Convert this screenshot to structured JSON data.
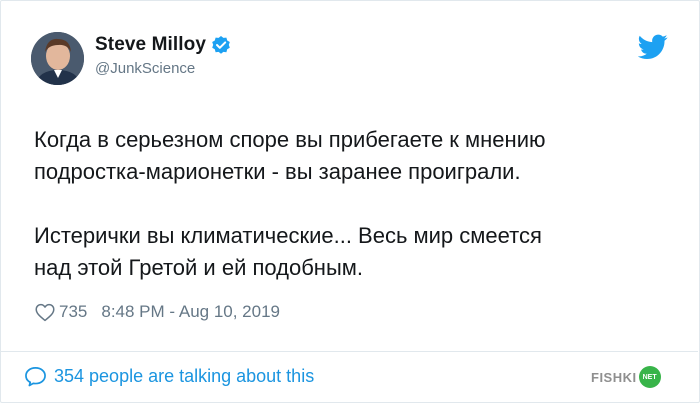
{
  "author": {
    "name": "Steve Milloy",
    "handle": "@JunkScience",
    "verified": true
  },
  "tweet": {
    "paragraphs": [
      [
        "Когда в серьезном споре вы прибегаете к мнению",
        "подростка-марионетки - вы заранее проиграли."
      ],
      [
        "Истерички вы климатические... Весь мир смеется",
        "над этой Гретой и ей подобным."
      ]
    ]
  },
  "stats": {
    "likes": "735",
    "timestamp": "8:48 PM - Aug 10, 2019"
  },
  "footer": {
    "talking": "354 people are talking about this"
  },
  "watermark": {
    "text": "FISHKI",
    "badge": "NET"
  },
  "icons": {
    "verified": "verified-badge-icon",
    "brand": "twitter-bird-icon",
    "like": "heart-icon",
    "reply": "speech-bubble-icon"
  },
  "colors": {
    "accent": "#1b95e0",
    "text": "#14171a",
    "secondary": "#657786",
    "border": "#e1e8ed",
    "watermark_badge": "#38b449"
  }
}
